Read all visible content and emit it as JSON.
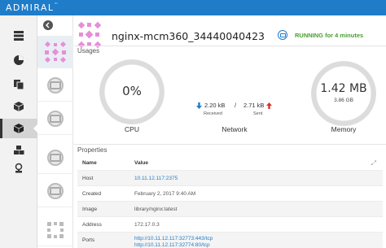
{
  "app": {
    "brand": "ADMIRAL",
    "tm": "™"
  },
  "nav": [
    {
      "name": "nav-hosts",
      "icon": "server-stack-icon"
    },
    {
      "name": "nav-dashboard",
      "icon": "pie-chart-icon"
    },
    {
      "name": "nav-templates",
      "icon": "copy-icon"
    },
    {
      "name": "nav-applications",
      "icon": "package-icon"
    },
    {
      "name": "nav-containers",
      "icon": "cube-icon",
      "active": true
    },
    {
      "name": "nav-networks",
      "icon": "cubes-icon"
    },
    {
      "name": "nav-registry",
      "icon": "stamp-icon"
    }
  ],
  "container": {
    "name": "nginx-mcm360_34440040423",
    "status": "RUNNING for 4 minutes"
  },
  "usages": {
    "label": "Usages",
    "cpu": {
      "value": "0%",
      "label": "CPU",
      "fraction": 0.0
    },
    "network": {
      "label": "Network",
      "received_value": "2.20 kB",
      "received_label": "Received",
      "separator": "/",
      "sent_value": "2.71 kB",
      "sent_label": "Sent"
    },
    "memory": {
      "value": "1.42 MB",
      "total": "3.86 GB",
      "label": "Memory",
      "fraction": 0.0004
    }
  },
  "properties": {
    "label": "Properties",
    "header": {
      "key": "Name",
      "value": "Value"
    },
    "rows": [
      {
        "key": "Host",
        "value": "10.11.12.117:2375",
        "link": true
      },
      {
        "key": "Created",
        "value": "February 2, 2017 9:40 AM",
        "link": false
      },
      {
        "key": "Image",
        "value": "library/nginx:latest",
        "link": false
      },
      {
        "key": "Address",
        "value": "172.17.0.3",
        "link": false
      },
      {
        "key": "Ports",
        "value": "http://10.11.12.117:32773:443/tcp",
        "value2": "http://10.11.12.117:32774:80/tcp",
        "link": true
      }
    ]
  },
  "colors": {
    "brand": "#1f7cc9",
    "running": "#4a9e2f",
    "received_arrow": "#1f7cc9",
    "sent_arrow": "#d9302b"
  }
}
